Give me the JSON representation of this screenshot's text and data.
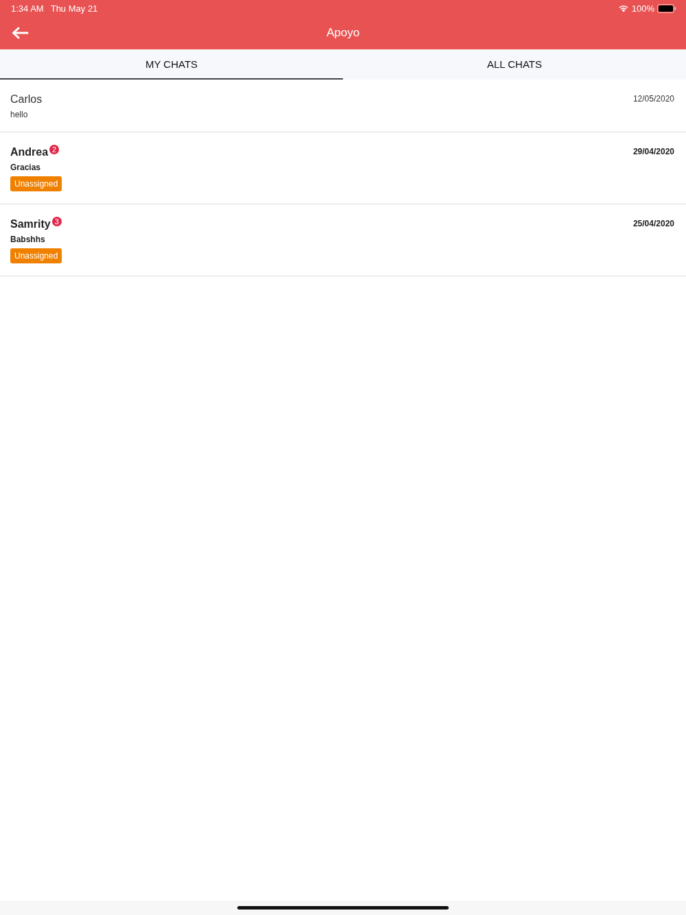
{
  "status_bar": {
    "time": "1:34 AM",
    "date": "Thu May 21",
    "battery": "100%"
  },
  "header": {
    "title": "Apoyo"
  },
  "tabs": [
    {
      "label": "MY CHATS",
      "selected": true
    },
    {
      "label": "ALL CHATS",
      "selected": false
    }
  ],
  "chats": [
    {
      "name": "Carlos",
      "message": "hello",
      "date": "12/05/2020",
      "unread": false
    },
    {
      "name": "Andrea",
      "badge": "2",
      "message": "Gracias",
      "date": "29/04/2020",
      "unread": true,
      "tag": "Unassigned"
    },
    {
      "name": "Samrity",
      "badge": "3",
      "message": "Babshhs",
      "date": "25/04/2020",
      "unread": true,
      "tag": "Unassigned"
    }
  ]
}
